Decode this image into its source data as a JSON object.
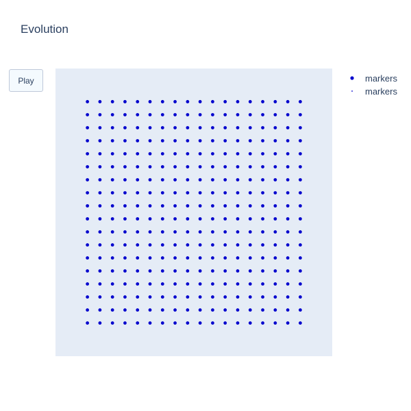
{
  "title": "Evolution",
  "controls": {
    "play_label": "Play"
  },
  "colors": {
    "plot_bg": "#e5ecf6",
    "marker": "#0000cd",
    "text": "#2a3f5f"
  },
  "legend": {
    "position": "top-right",
    "items": [
      {
        "label": "markers",
        "marker_size": "large"
      },
      {
        "label": "markers",
        "marker_size": "small"
      }
    ]
  },
  "chart_data": {
    "type": "scatter",
    "title": "Evolution",
    "xlabel": "",
    "ylabel": "",
    "grid": false,
    "axes_visible": false,
    "xlim": [
      -0.15,
      1.15
    ],
    "ylim": [
      -0.15,
      1.15
    ],
    "grid_points": {
      "columns": 18,
      "rows": 18,
      "x_range": [
        0,
        1
      ],
      "y_range": [
        0,
        1
      ]
    },
    "series": [
      {
        "name": "markers",
        "mode": "markers",
        "note": "18 x 18 uniform lattice of points"
      }
    ]
  }
}
